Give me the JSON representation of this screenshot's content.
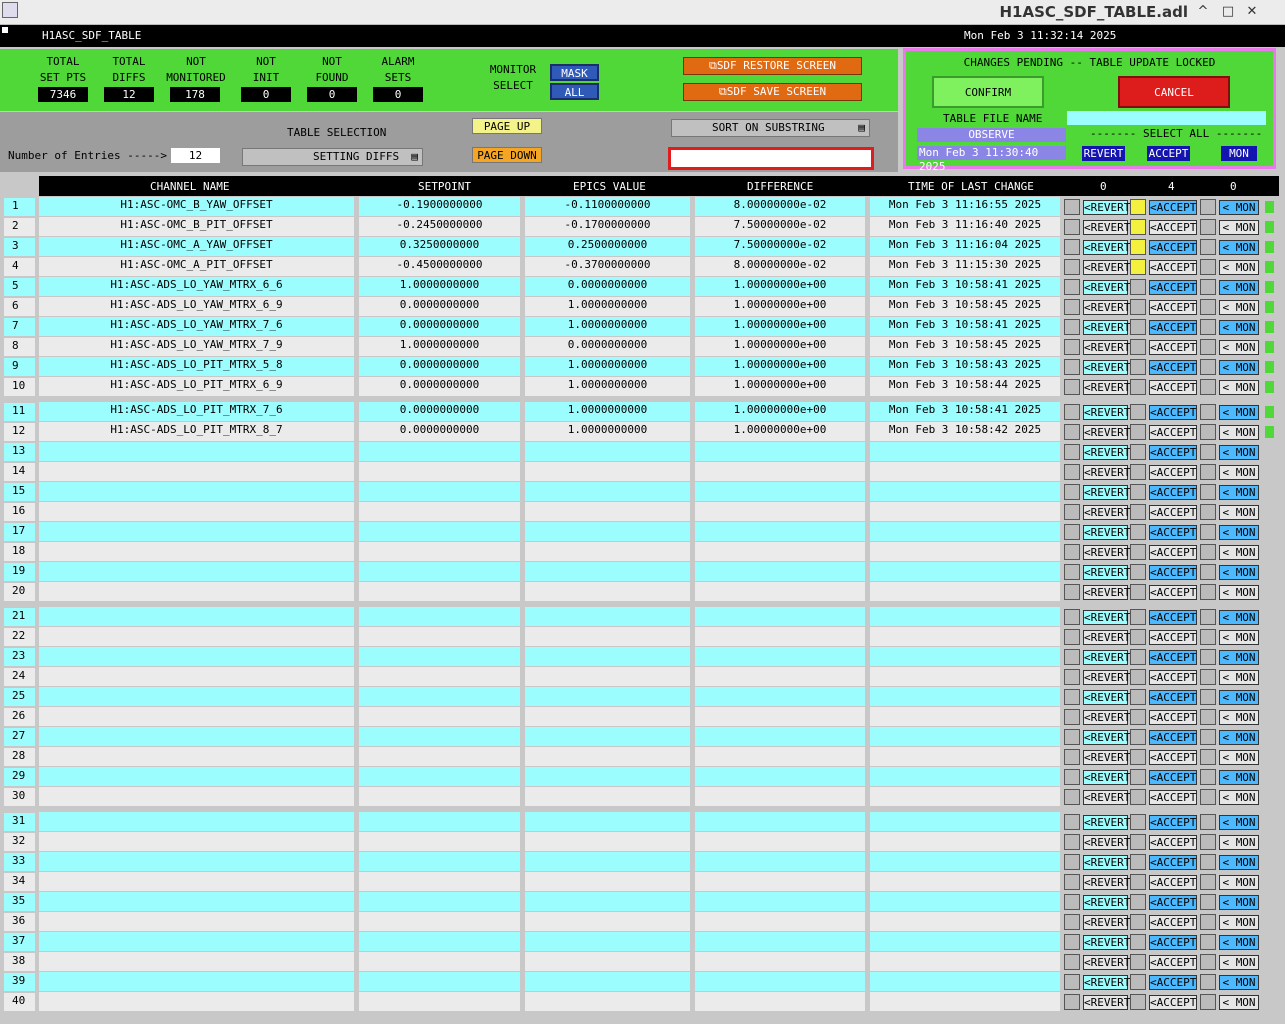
{
  "window": {
    "title": "H1ASC_SDF_TABLE.adl",
    "controls": [
      "^",
      "□",
      "✕"
    ]
  },
  "header": {
    "left": "H1ASC_SDF_TABLE",
    "right": "Mon Feb  3 11:32:14 2025"
  },
  "stats": [
    {
      "label1": "TOTAL",
      "label2": "SET PTS",
      "value": "7346"
    },
    {
      "label1": "TOTAL",
      "label2": "DIFFS",
      "value": "12"
    },
    {
      "label1": "NOT",
      "label2": "MONITORED",
      "value": "178"
    },
    {
      "label1": "NOT",
      "label2": "INIT",
      "value": "0"
    },
    {
      "label1": "NOT",
      "label2": "FOUND",
      "value": "0"
    },
    {
      "label1": "ALARM",
      "label2": "SETS",
      "value": "0"
    }
  ],
  "monitor": {
    "label1": "MONITOR",
    "label2": "SELECT",
    "mask": "MASK",
    "all": "ALL"
  },
  "screens": {
    "restore": "SDF RESTORE SCREEN",
    "save": "SDF SAVE SCREEN"
  },
  "controls": {
    "entries_label": "Number of Entries ----->",
    "entries_value": "12",
    "table_selection_label": "TABLE SELECTION",
    "table_selection_value": "SETTING DIFFS",
    "page_up": "PAGE UP",
    "page_down": "PAGE DOWN",
    "sort": "SORT ON SUBSTRING",
    "substring": ""
  },
  "pending": {
    "title": "CHANGES PENDING -- TABLE UPDATE LOCKED",
    "confirm": "CONFIRM",
    "cancel": "CANCEL",
    "table_file_label": "TABLE FILE NAME",
    "observe": "OBSERVE",
    "select_all": "------- SELECT ALL -------",
    "date": "Mon Feb  3 11:30:40 2025",
    "revert": "REVERT",
    "accept": "ACCEPT",
    "mon": "MON"
  },
  "table": {
    "headers": {
      "channel": "CHANNEL NAME",
      "setpoint": "SETPOINT",
      "epics": "EPICS VALUE",
      "diff": "DIFFERENCE",
      "time": "TIME OF LAST CHANGE",
      "c1": "0",
      "c2": "4",
      "c3": "0"
    },
    "btn_labels": {
      "revert": "REVERT",
      "accept": "ACCEPT",
      "mon": "MON"
    },
    "rows": [
      {
        "n": "1",
        "ch": "H1:ASC-OMC_B_YAW_OFFSET",
        "sp": "-0.1900000000",
        "ev": "-0.1100000000",
        "df": "8.00000000e-02",
        "t": "Mon Feb  3 11:16:55 2025"
      },
      {
        "n": "2",
        "ch": "H1:ASC-OMC_B_PIT_OFFSET",
        "sp": "-0.2450000000",
        "ev": "-0.1700000000",
        "df": "7.50000000e-02",
        "t": "Mon Feb  3 11:16:40 2025"
      },
      {
        "n": "3",
        "ch": "H1:ASC-OMC_A_YAW_OFFSET",
        "sp": "0.3250000000",
        "ev": "0.2500000000",
        "df": "7.50000000e-02",
        "t": "Mon Feb  3 11:16:04 2025"
      },
      {
        "n": "4",
        "ch": "H1:ASC-OMC_A_PIT_OFFSET",
        "sp": "-0.4500000000",
        "ev": "-0.3700000000",
        "df": "8.00000000e-02",
        "t": "Mon Feb  3 11:15:30 2025"
      },
      {
        "n": "5",
        "ch": "H1:ASC-ADS_LO_YAW_MTRX_6_6",
        "sp": "1.0000000000",
        "ev": "0.0000000000",
        "df": "1.00000000e+00",
        "t": "Mon Feb  3 10:58:41 2025"
      },
      {
        "n": "6",
        "ch": "H1:ASC-ADS_LO_YAW_MTRX_6_9",
        "sp": "0.0000000000",
        "ev": "1.0000000000",
        "df": "1.00000000e+00",
        "t": "Mon Feb  3 10:58:45 2025"
      },
      {
        "n": "7",
        "ch": "H1:ASC-ADS_LO_YAW_MTRX_7_6",
        "sp": "0.0000000000",
        "ev": "1.0000000000",
        "df": "1.00000000e+00",
        "t": "Mon Feb  3 10:58:41 2025"
      },
      {
        "n": "8",
        "ch": "H1:ASC-ADS_LO_YAW_MTRX_7_9",
        "sp": "1.0000000000",
        "ev": "0.0000000000",
        "df": "1.00000000e+00",
        "t": "Mon Feb  3 10:58:45 2025"
      },
      {
        "n": "9",
        "ch": "H1:ASC-ADS_LO_PIT_MTRX_5_8",
        "sp": "0.0000000000",
        "ev": "1.0000000000",
        "df": "1.00000000e+00",
        "t": "Mon Feb  3 10:58:43 2025"
      },
      {
        "n": "10",
        "ch": "H1:ASC-ADS_LO_PIT_MTRX_6_9",
        "sp": "0.0000000000",
        "ev": "1.0000000000",
        "df": "1.00000000e+00",
        "t": "Mon Feb  3 10:58:44 2025"
      },
      {
        "n": "11",
        "ch": "H1:ASC-ADS_LO_PIT_MTRX_7_6",
        "sp": "0.0000000000",
        "ev": "1.0000000000",
        "df": "1.00000000e+00",
        "t": "Mon Feb  3 10:58:41 2025"
      },
      {
        "n": "12",
        "ch": "H1:ASC-ADS_LO_PIT_MTRX_8_7",
        "sp": "0.0000000000",
        "ev": "1.0000000000",
        "df": "1.00000000e+00",
        "t": "Mon Feb  3 10:58:42 2025"
      },
      {
        "n": "13"
      },
      {
        "n": "14"
      },
      {
        "n": "15"
      },
      {
        "n": "16"
      },
      {
        "n": "17"
      },
      {
        "n": "18"
      },
      {
        "n": "19"
      },
      {
        "n": "20"
      },
      {
        "n": "21"
      },
      {
        "n": "22"
      },
      {
        "n": "23"
      },
      {
        "n": "24"
      },
      {
        "n": "25"
      },
      {
        "n": "26"
      },
      {
        "n": "27"
      },
      {
        "n": "28"
      },
      {
        "n": "29"
      },
      {
        "n": "30"
      },
      {
        "n": "31"
      },
      {
        "n": "32"
      },
      {
        "n": "33"
      },
      {
        "n": "34"
      },
      {
        "n": "35"
      },
      {
        "n": "36"
      },
      {
        "n": "37"
      },
      {
        "n": "38"
      },
      {
        "n": "39"
      },
      {
        "n": "40"
      }
    ],
    "accept_checked": [
      1,
      2,
      3,
      4
    ]
  },
  "colors": {
    "green": "#4fd837",
    "cyan": "#9cfdfe",
    "gray": "#ebebeb",
    "orange": "#e06a12",
    "red": "#dd1c1c",
    "blue": "#2f5ab8",
    "yellow": "#f4f13e"
  }
}
